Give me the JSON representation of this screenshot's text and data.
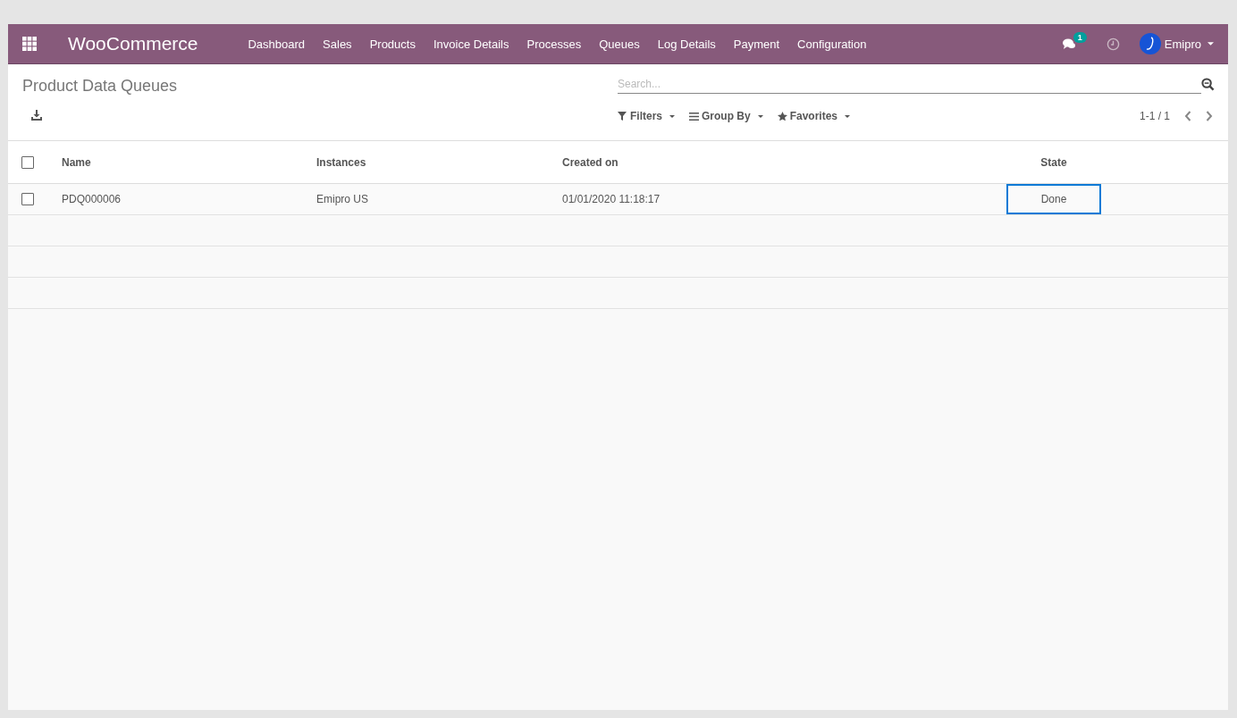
{
  "navbar": {
    "app_name": "WooCommerce",
    "menu": [
      "Dashboard",
      "Sales",
      "Products",
      "Invoice Details",
      "Processes",
      "Queues",
      "Log Details",
      "Payment",
      "Configuration"
    ],
    "messages_count": "1",
    "user": "Emipro"
  },
  "control_panel": {
    "title": "Product Data Queues",
    "search": {
      "placeholder": "Search..."
    },
    "filters": [
      {
        "kind": "filter",
        "label": "Filters"
      },
      {
        "kind": "group",
        "label": "Group By"
      },
      {
        "kind": "favorite",
        "label": "Favorites"
      }
    ],
    "pager": "1-1 / 1"
  },
  "table": {
    "columns": [
      "Name",
      "Instances",
      "Created on",
      "State"
    ],
    "all_checked": false,
    "rows": [
      {
        "checked": false,
        "cells": [
          {
            "text": "PDQ000006",
            "highlighted": false
          },
          {
            "text": "Emipro US",
            "highlighted": false
          },
          {
            "text": "01/01/2020 11:18:17",
            "highlighted": false
          },
          {
            "text": "Done",
            "highlighted": true
          }
        ]
      }
    ]
  }
}
